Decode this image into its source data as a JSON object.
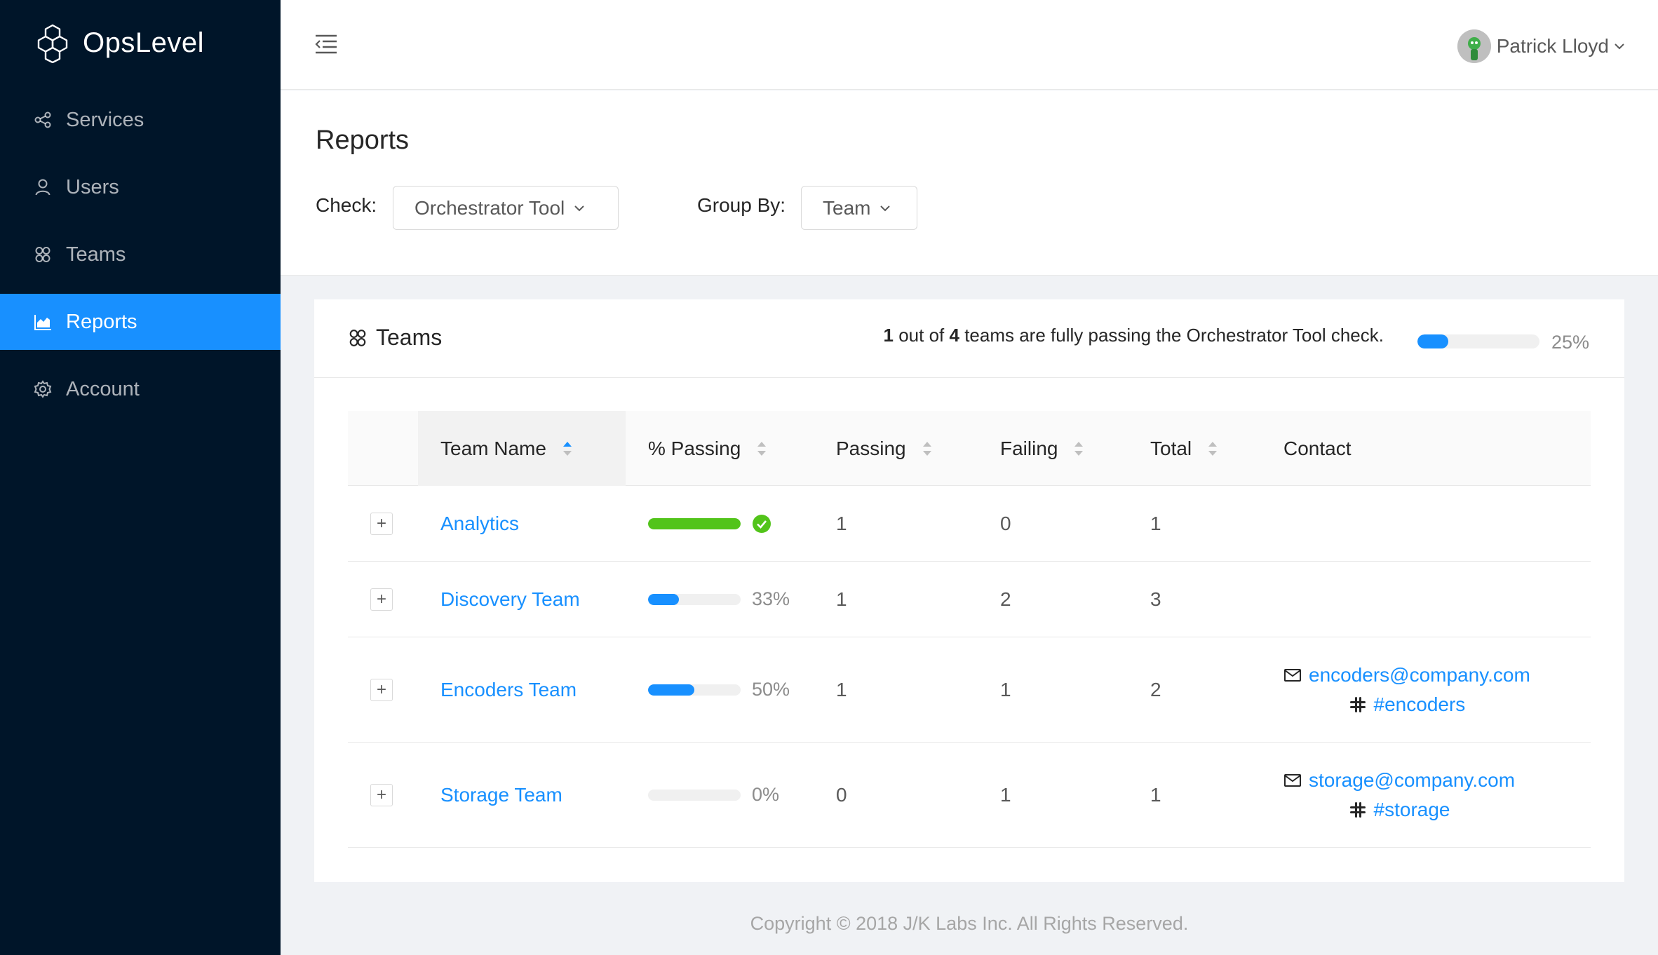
{
  "app": {
    "name": "OpsLevel"
  },
  "sidebar": {
    "items": [
      {
        "label": "Services",
        "icon": "share-nodes-icon"
      },
      {
        "label": "Users",
        "icon": "user-icon"
      },
      {
        "label": "Teams",
        "icon": "team-icon"
      },
      {
        "label": "Reports",
        "icon": "area-chart-icon",
        "active": true
      },
      {
        "label": "Account",
        "icon": "gear-icon"
      }
    ]
  },
  "header": {
    "user_name": "Patrick Lloyd"
  },
  "page": {
    "title": "Reports",
    "check_label": "Check",
    "check_value": "Orchestrator Tool",
    "group_label": "Group By",
    "group_value": "Team"
  },
  "card": {
    "title": "Teams",
    "summary": {
      "passing": "1",
      "out_of": " out of ",
      "total": "4",
      "text": " teams are fully passing the Orchestrator Tool check."
    },
    "progress_percent": 25,
    "progress_label": "25%"
  },
  "table": {
    "columns": [
      "Team Name",
      "% Passing",
      "Passing",
      "Failing",
      "Total",
      "Contact"
    ],
    "rows": [
      {
        "name": "Analytics",
        "percent": 100,
        "percent_label": "",
        "passing": "1",
        "failing": "0",
        "total": "1",
        "email": "",
        "slack": ""
      },
      {
        "name": "Discovery Team",
        "percent": 33,
        "percent_label": "33%",
        "passing": "1",
        "failing": "2",
        "total": "3",
        "email": "",
        "slack": ""
      },
      {
        "name": "Encoders Team",
        "percent": 50,
        "percent_label": "50%",
        "passing": "1",
        "failing": "1",
        "total": "2",
        "email": "encoders@company.com",
        "slack": "#encoders"
      },
      {
        "name": "Storage Team",
        "percent": 0,
        "percent_label": "0%",
        "passing": "0",
        "failing": "1",
        "total": "1",
        "email": "storage@company.com",
        "slack": "#storage"
      }
    ]
  },
  "footer": {
    "text": "Copyright © 2018 J/K Labs Inc. All Rights Reserved."
  },
  "colors": {
    "sidebar_bg": "#001529",
    "accent": "#1890ff",
    "success": "#52c41a"
  }
}
